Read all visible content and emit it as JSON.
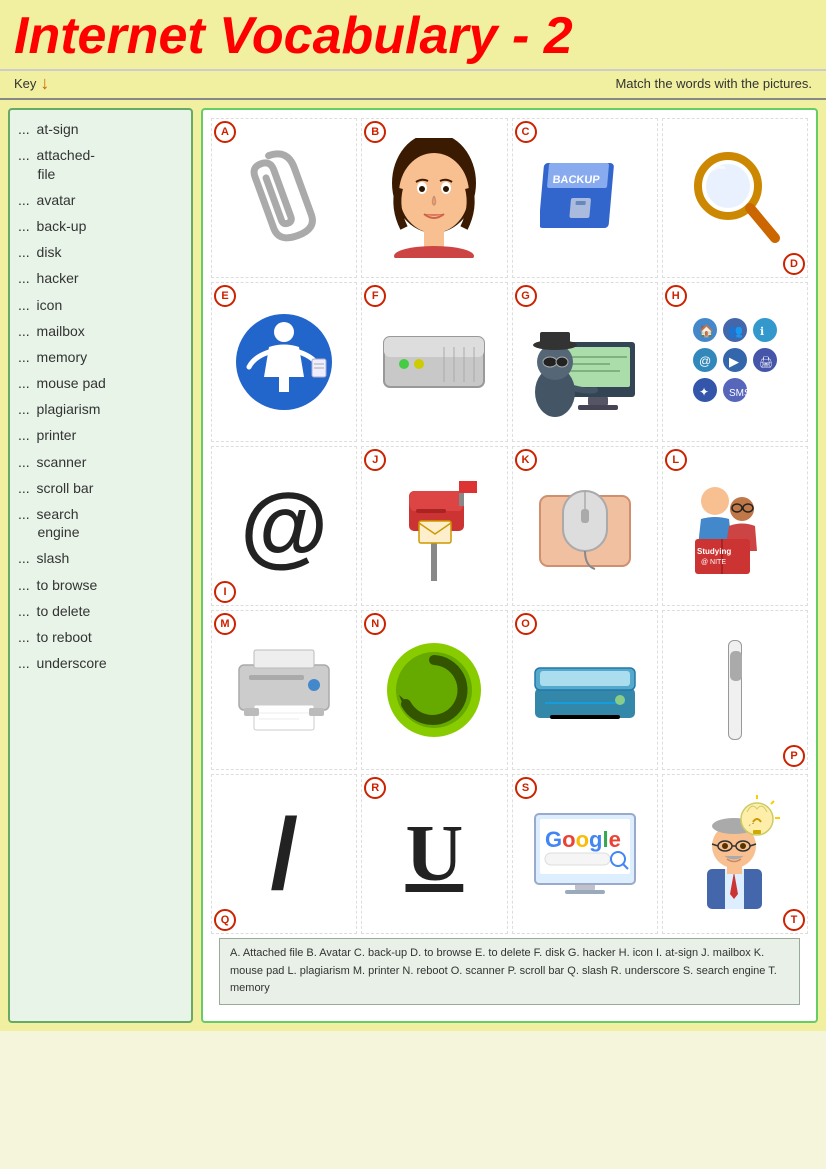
{
  "title": "Internet Vocabulary - 2",
  "sub_header": {
    "key_label": "Key",
    "match_instruction": "Match the words with the pictures."
  },
  "vocab_items": [
    "at-sign",
    "attached-file",
    "avatar",
    "back-up",
    "disk",
    "hacker",
    "icon",
    "mailbox",
    "memory",
    "mouse pad",
    "plagiarism",
    "printer",
    "scanner",
    "scroll bar",
    "search engine",
    "slash",
    "to browse",
    "to delete",
    "to reboot",
    "underscore"
  ],
  "grid_labels": [
    "A",
    "B",
    "C",
    "D",
    "E",
    "F",
    "G",
    "H",
    "I",
    "J",
    "K",
    "L",
    "M",
    "N",
    "O",
    "P",
    "Q",
    "R",
    "S",
    "T"
  ],
  "caption": "A. Attached file  B. Avatar  C. back-up  D. to browse  E. to delete  F. disk  G. hacker  H. icon    I. at-sign  J. mailbox  K. mouse pad  L. plagiarism  M. printer  N. reboot  O. scanner    P. scroll bar  Q. slash  R. underscore  S. search engine  T. memory"
}
